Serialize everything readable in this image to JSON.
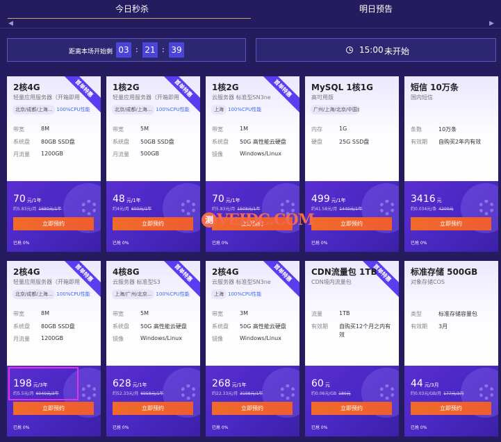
{
  "tabs": [
    {
      "label": "今日秒杀"
    },
    {
      "label": "明日预告"
    }
  ],
  "scroll": {
    "left_icon": "chevron-left-icon",
    "right_icon": "chevron-right-icon"
  },
  "countdown": {
    "label": "距离本场开始剩",
    "hours": "03",
    "minutes": "21",
    "seconds": "39",
    "sep": ":"
  },
  "session": {
    "icon": "clock-icon",
    "time": "15:00",
    "status": "未开始"
  },
  "watermark": {
    "badge": "测",
    "text": "VEIDC.COM"
  },
  "ribbon": "首单特惠",
  "colors": {
    "accent": "#4a44d8",
    "button": "#f06a2a",
    "page_bg": "#241c5e",
    "card_bottom": "#4a28c4",
    "highlight": "#e930e0"
  },
  "cards": [
    {
      "title": "2核4G",
      "subtitle": "轻量应用服务器（开箱即用",
      "region": "北京/成都/上海...",
      "perf": "100%CPU性能",
      "specs": [
        {
          "k": "带宽",
          "v": "8M"
        },
        {
          "k": "系统盘",
          "v": "80GB SSD盘"
        },
        {
          "k": "月流量",
          "v": "1200GB"
        }
      ],
      "price": "70",
      "unit": "元/1年",
      "per": "约5.83元/月",
      "orig": "1680元/1年",
      "btn": "立即预约",
      "sold": "已抢 0%"
    },
    {
      "title": "1核2G",
      "subtitle": "轻量应用服务器（开箱即用",
      "region": "北京/成都/上海...",
      "perf": "100%CPU性能",
      "specs": [
        {
          "k": "带宽",
          "v": "5M"
        },
        {
          "k": "系统盘",
          "v": "50GB SSD盘"
        },
        {
          "k": "月流量",
          "v": "500GB"
        }
      ],
      "price": "48",
      "unit": "元/1年",
      "per": "约4元/月",
      "orig": "600元/1年",
      "btn": "立即预约",
      "sold": "已抢 0%"
    },
    {
      "title": "1核2G",
      "subtitle": "云服务器 标准型SN3ne",
      "region": "上海",
      "perf": "100%CPU性能",
      "specs": [
        {
          "k": "带宽",
          "v": "1M"
        },
        {
          "k": "系统盘",
          "v": "50G 高性能云硬盘"
        },
        {
          "k": "镜像",
          "v": "Windows/Linux"
        }
      ],
      "price": "70",
      "unit": "元/1年",
      "per": "约5.83元/月",
      "orig": "1508元/1年",
      "btn": "立即预约",
      "sold": "已抢 0%"
    },
    {
      "title": "MySQL 1核1G",
      "subtitle": "高可用版",
      "region": "广州/上海/北京/中国香港/重庆/...",
      "perf": "",
      "specs": [
        {
          "k": "内存",
          "v": "1G"
        },
        {
          "k": "硬盘",
          "v": "25G SSD盘"
        }
      ],
      "price": "499",
      "unit": "元/1年",
      "per": "约41.58元/月",
      "orig": "1440元/1年",
      "btn": "立即预约",
      "sold": "已抢 0%"
    },
    {
      "title": "短信 10万条",
      "subtitle": "国内短信",
      "region": "",
      "perf": "",
      "specs": [
        {
          "k": "条数",
          "v": "10万条"
        },
        {
          "k": "有效期",
          "v": "自购买2年内有效"
        }
      ],
      "price": "3416",
      "unit": "元",
      "per": "约0.034元/条",
      "orig": "4200元",
      "btn": "立即预约",
      "sold": "已抢 0%"
    },
    {
      "title": "2核4G",
      "subtitle": "轻量应用服务器（开箱即用",
      "region": "北京/成都/上海...",
      "perf": "100%CPU性能",
      "specs": [
        {
          "k": "带宽",
          "v": "8M"
        },
        {
          "k": "系统盘",
          "v": "80GB SSD盘"
        },
        {
          "k": "月流量",
          "v": "1200GB"
        }
      ],
      "price": "198",
      "unit": "元/3年",
      "per": "约5.5元/月",
      "orig": "6040元/3年",
      "btn": "立即预约",
      "sold": "已抢 0%"
    },
    {
      "title": "4核8G",
      "subtitle": "云服务器 标准型S3",
      "region": "上海/广州/北京...",
      "perf": "100%CPU性能",
      "specs": [
        {
          "k": "带宽",
          "v": "5M"
        },
        {
          "k": "系统盘",
          "v": "50G 高性能云硬盘"
        },
        {
          "k": "镜像",
          "v": "Windows/Linux"
        }
      ],
      "price": "628",
      "unit": "元/1年",
      "per": "约52.33元/月",
      "orig": "6958元/1年",
      "btn": "立即预约",
      "sold": "已抢 0%"
    },
    {
      "title": "2核4G",
      "subtitle": "云服务器 标准型SN3ne",
      "region": "上海",
      "perf": "100%CPU性能",
      "specs": [
        {
          "k": "带宽",
          "v": "3M"
        },
        {
          "k": "系统盘",
          "v": "50G 高性能云硬盘"
        },
        {
          "k": "镜像",
          "v": "Windows/Linux"
        }
      ],
      "price": "268",
      "unit": "元/1年",
      "per": "约22.33元/月",
      "orig": "3198元/1年",
      "btn": "立即预约",
      "sold": "已抢 0%"
    },
    {
      "title": "CDN流量包 1TB",
      "subtitle": "CDN境内流量包",
      "region": "",
      "perf": "",
      "specs": [
        {
          "k": "流量",
          "v": "1TB"
        },
        {
          "k": "有效期",
          "v": "自购买12个月之内有效"
        }
      ],
      "price": "60",
      "unit": "元",
      "per": "约0.06元/GB",
      "orig": "180元",
      "btn": "立即预约",
      "sold": "已抢 0%"
    },
    {
      "title": "标准存储 500GB",
      "subtitle": "对象存储COS",
      "region": "",
      "perf": "",
      "specs": [
        {
          "k": "类型",
          "v": "标准存储容量包"
        },
        {
          "k": "有效期",
          "v": "3月"
        }
      ],
      "price": "44",
      "unit": "元/3月",
      "per": "约0.03元/GB/月",
      "orig": "177元/3月",
      "btn": "立即预约",
      "sold": "已抢 0%"
    }
  ]
}
